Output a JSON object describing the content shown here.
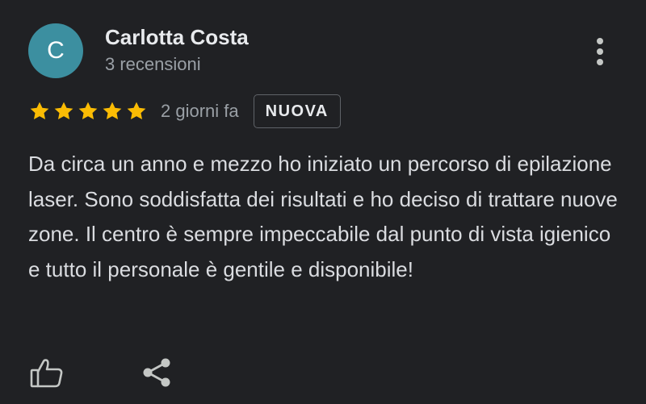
{
  "review": {
    "author": {
      "initial": "C",
      "name": "Carlotta Costa",
      "meta": "3 recensioni",
      "avatar_color": "#3c8fa0"
    },
    "rating": {
      "stars": 5,
      "max": 5,
      "star_color": "#fbbc04"
    },
    "date": "2 giorni fa",
    "badge": "NUOVA",
    "text": "Da circa un anno e mezzo ho iniziato un percorso di epilazione laser. Sono soddisfatta dei risultati e ho deciso di trattare nuove zone. Il centro è sempre impeccabile dal punto di vista igienico e tutto il personale è gentile e disponibile!"
  },
  "icons": {
    "more": "more-vert-icon",
    "like": "thumb-up-icon",
    "share": "share-icon",
    "star": "star-icon"
  },
  "theme": {
    "background": "#202124",
    "text_primary": "#e8eaed",
    "text_secondary": "#9aa0a6"
  }
}
